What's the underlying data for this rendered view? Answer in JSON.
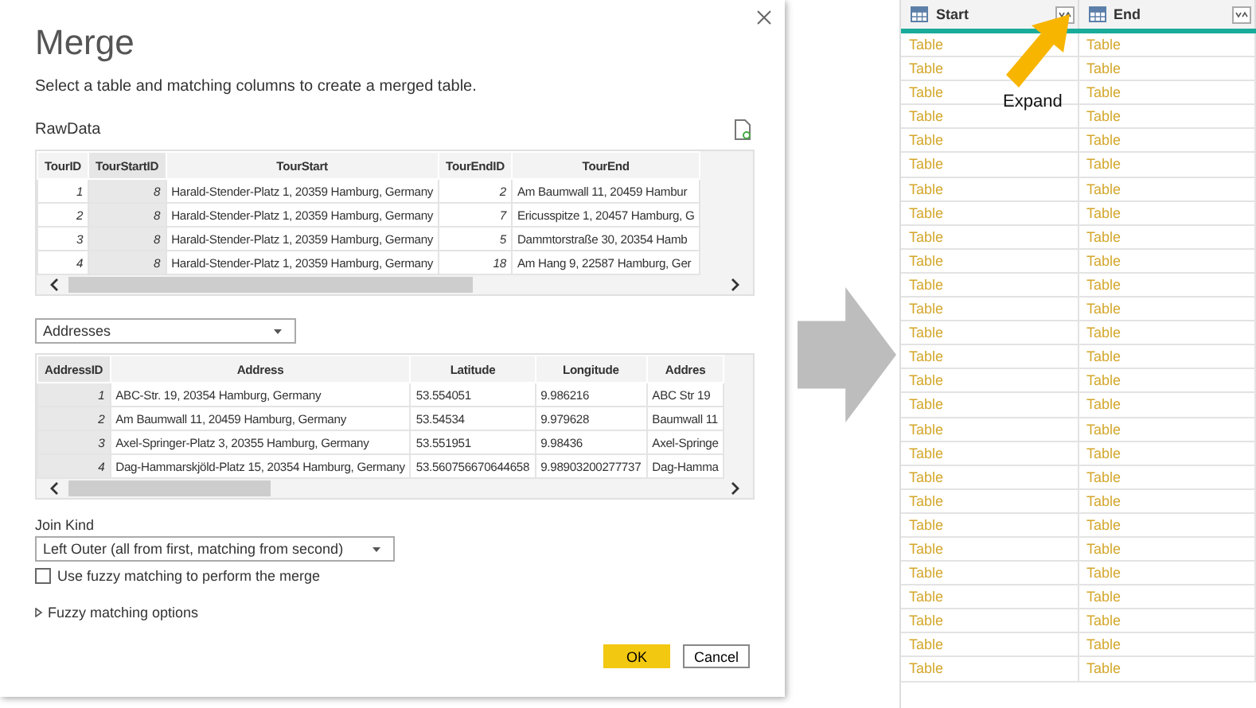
{
  "dialog": {
    "title": "Merge",
    "description": "Select a table and matching columns to create a merged table.",
    "first_table": {
      "name": "RawData",
      "columns": [
        {
          "label": "TourID",
          "kind": "number",
          "selected": false
        },
        {
          "label": "TourStartID",
          "kind": "number",
          "selected": true
        },
        {
          "label": "TourStart",
          "kind": "text",
          "selected": false
        },
        {
          "label": "TourEndID",
          "kind": "number",
          "selected": false
        },
        {
          "label": "TourEnd",
          "kind": "text",
          "selected": false
        }
      ],
      "rows": [
        [
          "1",
          "8",
          "Harald-Stender-Platz 1, 20359 Hamburg, Germany",
          "2",
          "Am Baumwall 11, 20459 Hambur"
        ],
        [
          "2",
          "8",
          "Harald-Stender-Platz 1, 20359 Hamburg, Germany",
          "7",
          "Ericusspitze 1, 20457 Hamburg, G"
        ],
        [
          "3",
          "8",
          "Harald-Stender-Platz 1, 20359 Hamburg, Germany",
          "5",
          "Dammtorstraße 30, 20354 Hamb"
        ],
        [
          "4",
          "8",
          "Harald-Stender-Platz 1, 20359 Hamburg, Germany",
          "18",
          "Am Hang 9, 22587 Hamburg, Ger"
        ]
      ]
    },
    "table_select": {
      "value": "Addresses"
    },
    "second_table": {
      "columns": [
        {
          "label": "AddressID",
          "kind": "number",
          "selected": true
        },
        {
          "label": "Address",
          "kind": "text",
          "selected": false
        },
        {
          "label": "Latitude",
          "kind": "text",
          "selected": false
        },
        {
          "label": "Longitude",
          "kind": "text",
          "selected": false
        },
        {
          "label": "Addres",
          "kind": "text",
          "selected": false
        }
      ],
      "rows": [
        [
          "1",
          "ABC-Str. 19, 20354 Hamburg, Germany",
          "53.554051",
          "9.986216",
          "ABC Str 19"
        ],
        [
          "2",
          "Am Baumwall 11, 20459 Hamburg, Germany",
          "53.54534",
          "9.979628",
          "Baumwall 11"
        ],
        [
          "3",
          "Axel-Springer-Platz 3, 20355 Hamburg, Germany",
          "53.551951",
          "9.98436",
          "Axel-Springe"
        ],
        [
          "4",
          "Dag-Hammarskjöld-Platz 15, 20354 Hamburg, Germany",
          "53.560756670644658",
          "9.98903200277737",
          "Dag-Hamma"
        ]
      ]
    },
    "join_kind": {
      "label": "Join Kind",
      "value": "Left Outer (all from first, matching from second)"
    },
    "fuzzy_checkbox": {
      "label": "Use fuzzy matching to perform the merge",
      "checked": false
    },
    "fuzzy_options": {
      "label": "Fuzzy matching options",
      "expanded": false
    },
    "buttons": [
      {
        "label": "OK",
        "kind": "primary"
      },
      {
        "label": "Cancel",
        "kind": "secondary"
      }
    ]
  },
  "result_table": {
    "columns": [
      {
        "label": "Start"
      },
      {
        "label": "End"
      }
    ],
    "rows": [
      [
        "Table",
        "Table"
      ],
      [
        "Table",
        "Table"
      ],
      [
        "Table",
        "Table"
      ],
      [
        "Table",
        "Table"
      ],
      [
        "Table",
        "Table"
      ],
      [
        "Table",
        "Table"
      ],
      [
        "Table",
        "Table"
      ],
      [
        "Table",
        "Table"
      ],
      [
        "Table",
        "Table"
      ],
      [
        "Table",
        "Table"
      ],
      [
        "Table",
        "Table"
      ],
      [
        "Table",
        "Table"
      ],
      [
        "Table",
        "Table"
      ],
      [
        "Table",
        "Table"
      ],
      [
        "Table",
        "Table"
      ],
      [
        "Table",
        "Table"
      ],
      [
        "Table",
        "Table"
      ],
      [
        "Table",
        "Table"
      ],
      [
        "Table",
        "Table"
      ],
      [
        "Table",
        "Table"
      ],
      [
        "Table",
        "Table"
      ],
      [
        "Table",
        "Table"
      ],
      [
        "Table",
        "Table"
      ],
      [
        "Table",
        "Table"
      ],
      [
        "Table",
        "Table"
      ],
      [
        "Table",
        "Table"
      ],
      [
        "Table",
        "Table"
      ]
    ]
  },
  "annotation": {
    "label": "Expand"
  }
}
